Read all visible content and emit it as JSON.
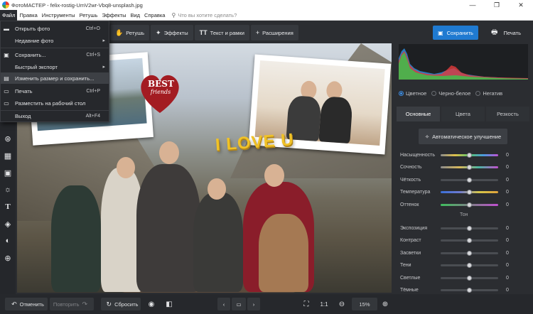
{
  "window": {
    "title": "ФотоМАСТЕР - felix-rostig-UmV2wr-Vbq8-unsplash.jpg",
    "controls": [
      "—",
      "❐",
      "✕"
    ]
  },
  "menu": {
    "items": [
      "Файл",
      "Правка",
      "Инструменты",
      "Ретушь",
      "Эффекты",
      "Вид",
      "Справка"
    ],
    "search_placeholder": "Что вы хотите сделать?"
  },
  "file_menu": {
    "items": [
      {
        "label": "Открыть фото",
        "shortcut": "Ctrl+O",
        "icon": "folder-icon"
      },
      {
        "label": "Недавние фото",
        "shortcut": "",
        "icon": "",
        "submenu": true
      },
      {
        "label": "Сохранить...",
        "shortcut": "Ctrl+S",
        "icon": "save-icon"
      },
      {
        "label": "Быстрый экспорт",
        "shortcut": "",
        "icon": "",
        "submenu": true
      },
      {
        "label": "Изменить размер и сохранить...",
        "shortcut": "",
        "icon": "resize-icon"
      },
      {
        "label": "Печать",
        "shortcut": "Ctrl+P",
        "icon": "printer-icon"
      },
      {
        "label": "Разместить на рабочий стол",
        "shortcut": "",
        "icon": "desktop-icon"
      },
      {
        "label": "Выход",
        "shortcut": "Alt+F4",
        "icon": ""
      }
    ],
    "hovered_index": 4
  },
  "toolbar": {
    "retouch": "Ретушь",
    "effects": "Эффекты",
    "text": "Текст и рамки",
    "extensions": "Расширения"
  },
  "actions": {
    "save": "Сохранить",
    "print": "Печать"
  },
  "canvas": {
    "sticker_best": "BEST",
    "sticker_friends": "friends",
    "text_overlay": "I LOVE U"
  },
  "color_mode": {
    "options": [
      "Цветное",
      "Черно-белое",
      "Негатив"
    ],
    "selected": "Цветное"
  },
  "tabs": [
    "Основные",
    "Цвета",
    "Резкость"
  ],
  "active_tab": "Основные",
  "auto_enhance": "Автоматическое улучшение",
  "sliders_basic": [
    {
      "label": "Насыщенность",
      "value": "0",
      "fraction": 0.5,
      "track": "saturation"
    },
    {
      "label": "Сочность",
      "value": "0",
      "fraction": 0.5,
      "track": "vibrance"
    },
    {
      "label": "Чёткость",
      "value": "0",
      "fraction": 0.5,
      "track": "neutral"
    },
    {
      "label": "Температура",
      "value": "0",
      "fraction": 0.5,
      "track": "temperature"
    },
    {
      "label": "Оттенок",
      "value": "0",
      "fraction": 0.5,
      "track": "tint"
    }
  ],
  "tone_header": "Тон",
  "sliders_tone": [
    {
      "label": "Экспозиция",
      "value": "0",
      "fraction": 0.5
    },
    {
      "label": "Контраст",
      "value": "0",
      "fraction": 0.5
    },
    {
      "label": "Засветки",
      "value": "0",
      "fraction": 0.5
    },
    {
      "label": "Тени",
      "value": "0",
      "fraction": 0.5
    },
    {
      "label": "Светлые",
      "value": "0",
      "fraction": 0.5
    },
    {
      "label": "Тёмные",
      "value": "0",
      "fraction": 0.5
    }
  ],
  "bottom": {
    "undo": "Отменить",
    "redo": "Повторить",
    "reset": "Сбросить",
    "zoom_ratio": "1:1",
    "zoom_value": "15%"
  },
  "colors": {
    "accent": "#1f7ad1",
    "panel_bg": "#2b2d31",
    "menu_bg": "#26282c",
    "highlight": "#3d4045"
  }
}
